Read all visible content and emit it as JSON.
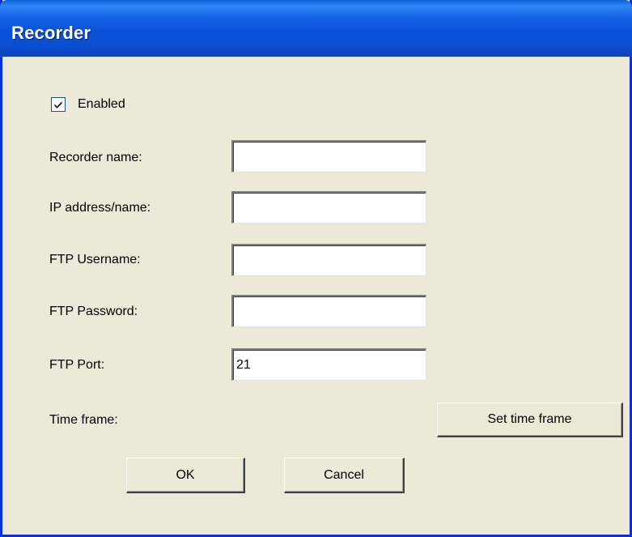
{
  "window": {
    "title": "Recorder"
  },
  "form": {
    "enabled_label": "Enabled",
    "enabled_checked": true,
    "recorder_name_label": "Recorder name:",
    "recorder_name_value": "",
    "ip_label": "IP address/name:",
    "ip_value": "",
    "ftp_username_label": "FTP Username:",
    "ftp_username_value": "",
    "ftp_password_label": "FTP Password:",
    "ftp_password_value": "",
    "ftp_port_label": "FTP Port:",
    "ftp_port_value": "21",
    "time_frame_label": "Time frame:",
    "set_time_frame_label": "Set time frame"
  },
  "buttons": {
    "ok_label": "OK",
    "cancel_label": "Cancel"
  },
  "colors": {
    "titlebar": "#0a51d8",
    "dialog_bg": "#ece9d8",
    "checkbox_border": "#1c5180"
  },
  "icons": {
    "checkbox": "checkmark-icon"
  }
}
